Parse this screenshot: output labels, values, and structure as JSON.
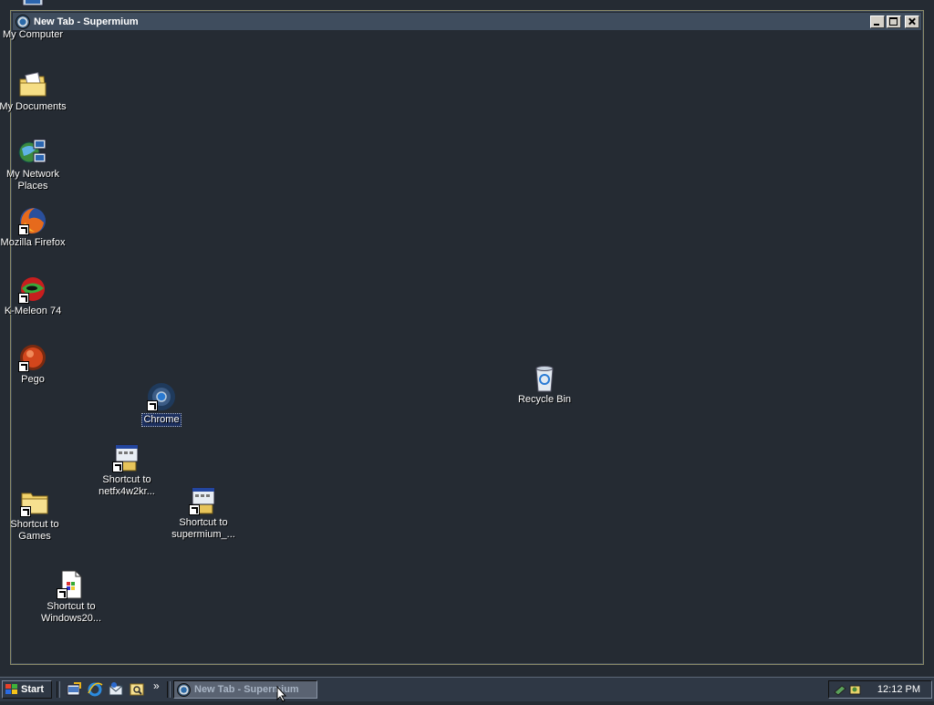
{
  "window": {
    "title": "New Tab - Supermium",
    "controls": {
      "minimize": "minimize",
      "maximize": "maximize",
      "close": "close"
    }
  },
  "desktop_icons": [
    {
      "name": "my-computer",
      "label": "My Computer",
      "icon": "computer-icon"
    },
    {
      "name": "my-documents",
      "label": "My Documents",
      "icon": "folder-documents-icon"
    },
    {
      "name": "my-network-places",
      "label": "My Network\nPlaces",
      "icon": "network-icon"
    },
    {
      "name": "mozilla-firefox",
      "label": "Mozilla Firefox",
      "icon": "firefox-icon",
      "shortcut": true
    },
    {
      "name": "k-meleon",
      "label": "K-Meleon 74",
      "icon": "k-meleon-icon",
      "shortcut": true
    },
    {
      "name": "pego",
      "label": "Pego",
      "icon": "pego-icon",
      "shortcut": true
    },
    {
      "name": "chrome",
      "label": "Chrome",
      "icon": "chrome-icon",
      "shortcut": true,
      "selected": true
    },
    {
      "name": "shortcut-netfx",
      "label": "Shortcut to\nnetfx4w2kr...",
      "icon": "installer-icon",
      "shortcut": true
    },
    {
      "name": "shortcut-supermium",
      "label": "Shortcut to\nsupermium_...",
      "icon": "installer-icon",
      "shortcut": true
    },
    {
      "name": "shortcut-games",
      "label": "Shortcut to\nGames",
      "icon": "folder-icon",
      "shortcut": true
    },
    {
      "name": "shortcut-windows20",
      "label": "Shortcut to\nWindows20...",
      "icon": "document-icon",
      "shortcut": true
    },
    {
      "name": "recycle-bin",
      "label": "Recycle Bin",
      "icon": "recycle-bin-icon"
    }
  ],
  "taskbar": {
    "start_label": "Start",
    "quick_launch": [
      "show-desktop-icon",
      "internet-explorer-icon",
      "outlook-express-icon",
      "search-icon"
    ],
    "quick_launch_more": "»",
    "task_button_label": "New Tab - Supermium",
    "clock": "12:12 PM"
  },
  "colors": {
    "desktop_bg": "#252b33",
    "titlebar_bg": "#3f4d5e",
    "taskbar_bg": "#2f3845",
    "selection": "#1c2f5e"
  }
}
